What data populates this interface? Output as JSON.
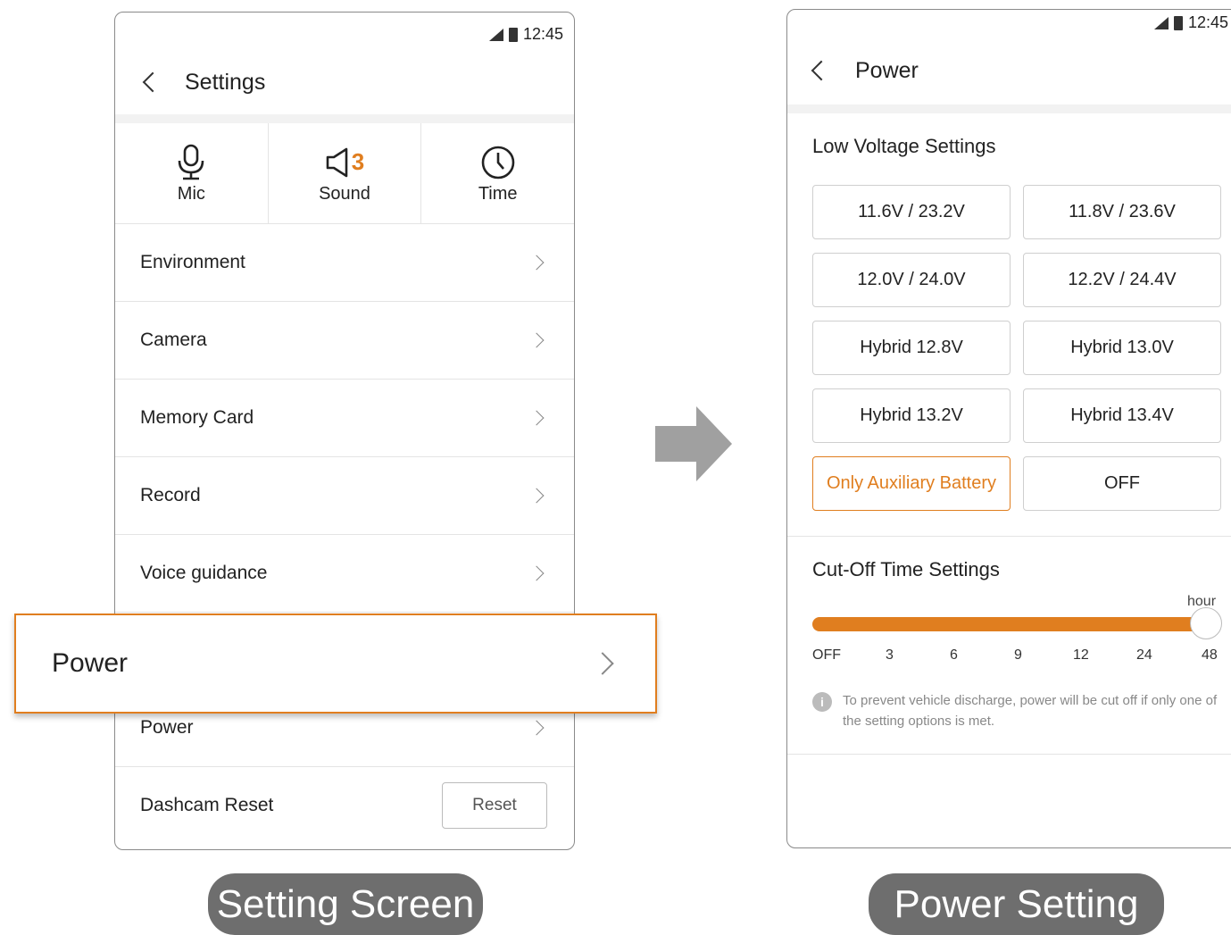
{
  "settings_screen": {
    "status_time": "12:45",
    "title": "Settings",
    "quick": [
      {
        "icon": "microphone-icon",
        "label": "Mic"
      },
      {
        "icon": "speaker-icon",
        "label": "Sound",
        "value": "3"
      },
      {
        "icon": "clock-icon",
        "label": "Time"
      }
    ],
    "items": [
      "Environment",
      "Camera",
      "Memory Card",
      "Record",
      "Voice guidance",
      "Power"
    ],
    "reset_row": {
      "label": "Dashcam Reset",
      "button": "Reset"
    }
  },
  "callout": {
    "label": "Power"
  },
  "power_screen": {
    "status_time": "12:45",
    "title": "Power",
    "low_voltage_title": "Low Voltage Settings",
    "options": [
      "11.6V / 23.2V",
      "11.8V / 23.6V",
      "12.0V / 24.0V",
      "12.2V / 24.4V",
      "Hybrid 12.8V",
      "Hybrid 13.0V",
      "Hybrid 13.2V",
      "Hybrid 13.4V",
      "Only Auxiliary Battery",
      "OFF"
    ],
    "selected_option": "Only Auxiliary Battery",
    "cutoff_title": "Cut-Off Time Settings",
    "slider_unit": "hour",
    "slider_ticks": [
      "OFF",
      "3",
      "6",
      "9",
      "12",
      "24",
      "48"
    ],
    "slider_value": "48",
    "info_text": "To prevent vehicle discharge, power will be cut off if only one of the setting options is met."
  },
  "captions": {
    "left": "Setting Screen",
    "right": "Power Setting"
  },
  "colors": {
    "accent": "#e07e1f",
    "caption_bg": "#6e6e6e",
    "arrow": "#a0a0a0"
  }
}
